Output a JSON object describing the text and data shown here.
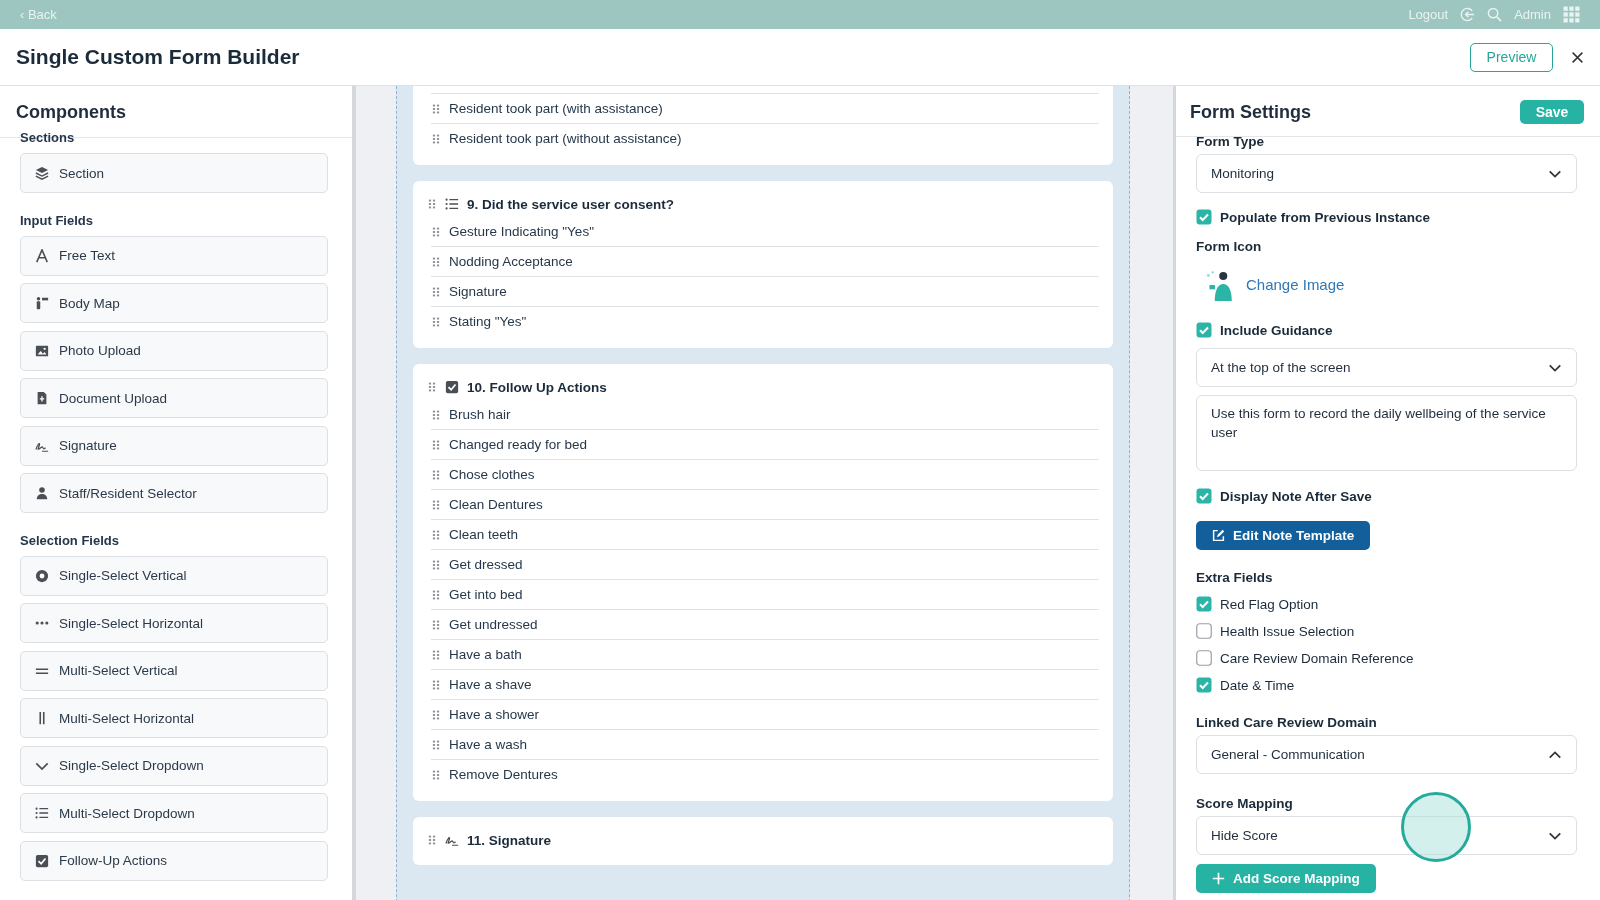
{
  "top_bar": {
    "back": "‹ Back",
    "logout": "Logout",
    "user": "Admin"
  },
  "header": {
    "title": "Single Custom Form Builder",
    "preview_button": "Preview"
  },
  "components": {
    "title": "Components",
    "groups": [
      {
        "label": "Sections",
        "items": [
          {
            "kind": "section",
            "label": "Section"
          }
        ]
      },
      {
        "label": "Input Fields",
        "items": [
          {
            "kind": "text",
            "label": "Free Text"
          },
          {
            "kind": "bodymap",
            "label": "Body Map"
          },
          {
            "kind": "photo",
            "label": "Photo Upload"
          },
          {
            "kind": "document",
            "label": "Document Upload"
          },
          {
            "kind": "signature",
            "label": "Signature"
          },
          {
            "kind": "person",
            "label": "Staff/Resident Selector"
          }
        ]
      },
      {
        "label": "Selection Fields",
        "items": [
          {
            "kind": "radio",
            "label": "Single-Select Vertical"
          },
          {
            "kind": "dots",
            "label": "Single-Select Horizontal"
          },
          {
            "kind": "hlines",
            "label": "Multi-Select Vertical"
          },
          {
            "kind": "vlines",
            "label": "Multi-Select Horizontal"
          },
          {
            "kind": "chevron",
            "label": "Single-Select Dropdown"
          },
          {
            "kind": "list",
            "label": "Multi-Select Dropdown"
          },
          {
            "kind": "checkbox",
            "label": "Follow-Up Actions"
          }
        ]
      }
    ]
  },
  "canvas": {
    "questions": [
      {
        "kind": "none",
        "options": [
          "Resident took part (with assistance)",
          "Resident took part (without assistance)"
        ]
      },
      {
        "kind": "list",
        "title": "9. Did the service user consent?",
        "options": [
          "Gesture Indicating \"Yes\"",
          "Nodding Acceptance",
          "Signature",
          "Stating \"Yes\""
        ]
      },
      {
        "kind": "checkbox",
        "title": "10. Follow Up Actions",
        "options": [
          "Brush hair",
          "Changed ready for bed",
          "Chose clothes",
          "Clean Dentures",
          "Clean teeth",
          "Get dressed",
          "Get into bed",
          "Get undressed",
          "Have a bath",
          "Have a shave",
          "Have a shower",
          "Have a wash",
          "Remove Dentures"
        ]
      },
      {
        "kind": "signature",
        "title": "11. Signature"
      }
    ]
  },
  "settings": {
    "title": "Form Settings",
    "save_button": "Save",
    "form_type": {
      "label": "Form Type",
      "value": "Monitoring",
      "expanded": false
    },
    "populate_previous": {
      "label": "Populate from Previous Instance",
      "checked": true
    },
    "form_icon": {
      "label": "Form Icon",
      "link": "Change Image"
    },
    "include_guidance": {
      "label": "Include Guidance",
      "checked": true
    },
    "guidance_position": {
      "value": "At the top of the screen",
      "expanded": false
    },
    "guidance_text": {
      "value": "Use this form to record the daily wellbeing of the service user"
    },
    "display_note": {
      "label": "Display Note After Save",
      "checked": true
    },
    "edit_note_button": "Edit Note Template",
    "extra_fields": {
      "label": "Extra Fields",
      "options": [
        {
          "label": "Red Flag Option",
          "checked": true
        },
        {
          "label": "Health Issue Selection",
          "checked": false
        },
        {
          "label": "Care Review Domain Reference",
          "checked": false
        },
        {
          "label": "Date & Time",
          "checked": true
        }
      ]
    },
    "linked_domain": {
      "label": "Linked Care Review Domain",
      "value": "General - Communication",
      "expanded": true
    },
    "score_mapping": {
      "label": "Score Mapping",
      "value": "Hide Score",
      "expanded": false
    },
    "add_score_button": "Add Score Mapping"
  }
}
